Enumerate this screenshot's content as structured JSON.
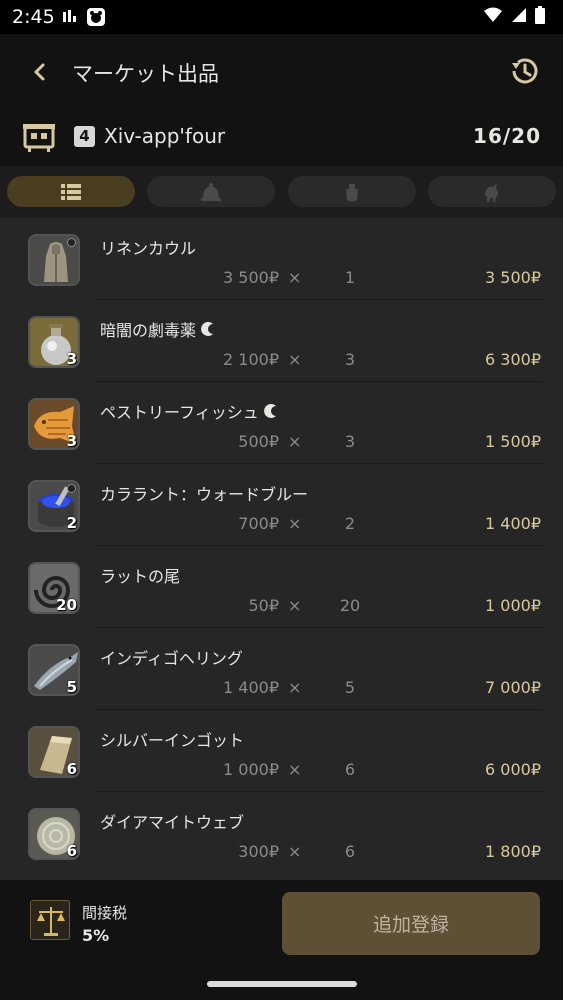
{
  "status_bar": {
    "time": "2:45"
  },
  "header": {
    "title": "マーケット出品",
    "back_icon": "chevron-left-icon",
    "history_icon": "history-icon"
  },
  "retainer": {
    "world_badge": "4",
    "name": "Xiv-app'four",
    "slots": "16/20"
  },
  "tabs": [
    {
      "icon": "list-icon",
      "active": true
    },
    {
      "icon": "bell-icon",
      "active": false
    },
    {
      "icon": "pot-icon",
      "active": false
    },
    {
      "icon": "chocobo-icon",
      "active": false
    }
  ],
  "items": [
    {
      "name": "リネンカウル",
      "unit_price": "3 500",
      "times": "×",
      "quantity": "1",
      "total": "3 500",
      "thumb_qty": "",
      "hq": false,
      "icon": "robe-icon"
    },
    {
      "name": "暗闇の劇毒薬",
      "unit_price": "2 100",
      "times": "×",
      "quantity": "3",
      "total": "6 300",
      "thumb_qty": "3",
      "hq": true,
      "icon": "potion-icon"
    },
    {
      "name": "ペストリーフィッシュ",
      "unit_price": "500",
      "times": "×",
      "quantity": "3",
      "total": "1 500",
      "thumb_qty": "3",
      "hq": true,
      "icon": "taiyaki-icon"
    },
    {
      "name": "カララント：ウォードブルー",
      "unit_price": "700",
      "times": "×",
      "quantity": "2",
      "total": "1 400",
      "thumb_qty": "2",
      "hq": false,
      "icon": "dye-icon"
    },
    {
      "name": "ラットの尾",
      "unit_price": "50",
      "times": "×",
      "quantity": "20",
      "total": "1 000",
      "thumb_qty": "20",
      "hq": false,
      "icon": "tail-icon"
    },
    {
      "name": "インディゴヘリング",
      "unit_price": "1 400",
      "times": "×",
      "quantity": "5",
      "total": "7 000",
      "thumb_qty": "5",
      "hq": false,
      "icon": "fish-icon"
    },
    {
      "name": "シルバーインゴット",
      "unit_price": "1 000",
      "times": "×",
      "quantity": "6",
      "total": "6 000",
      "thumb_qty": "6",
      "hq": false,
      "icon": "ingot-icon"
    },
    {
      "name": "ダイアマイトウェブ",
      "unit_price": "300",
      "times": "×",
      "quantity": "6",
      "total": "1 800",
      "thumb_qty": "6",
      "hq": false,
      "icon": "web-icon"
    }
  ],
  "currency_symbol": "₽",
  "footer": {
    "tax_label": "間接税",
    "tax_value": "5%",
    "add_button": "追加登録"
  },
  "colors": {
    "accent": "#d8c89f",
    "button": "#5e5034"
  }
}
